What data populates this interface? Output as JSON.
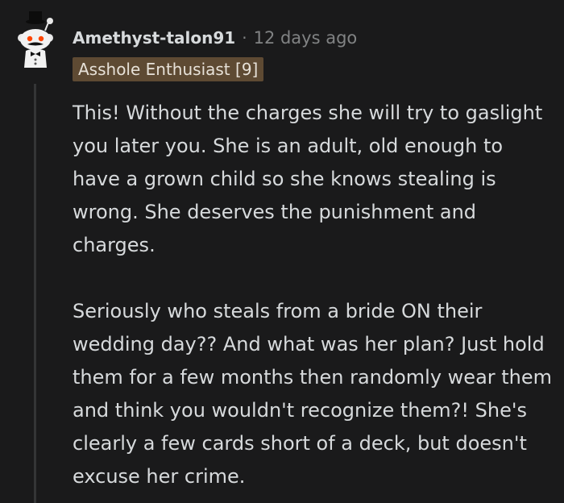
{
  "comment": {
    "username": "Amethyst-talon91",
    "separator": "·",
    "timestamp": "12 days ago",
    "flair": "Asshole Enthusiast [9]",
    "paragraphs": [
      "This! Without the charges she will try to gaslight you later you. She is an adult, old enough to have a grown child so she knows stealing is wrong. She deserves the punishment and charges.",
      "Seriously who steals from a bride ON their wedding day?? And what was her plan? Just hold them for a few months then randomly wear them and think you wouldn't recognize them?! She's clearly a few cards short of a deck, but doesn't excuse her crime."
    ]
  },
  "colors": {
    "background": "#1a1a1b",
    "text": "#d7dadc",
    "meta": "#818384",
    "flair_bg": "#5e4a33",
    "thread_line": "#343536"
  },
  "icons": {
    "avatar": "snoo-avatar-icon"
  }
}
